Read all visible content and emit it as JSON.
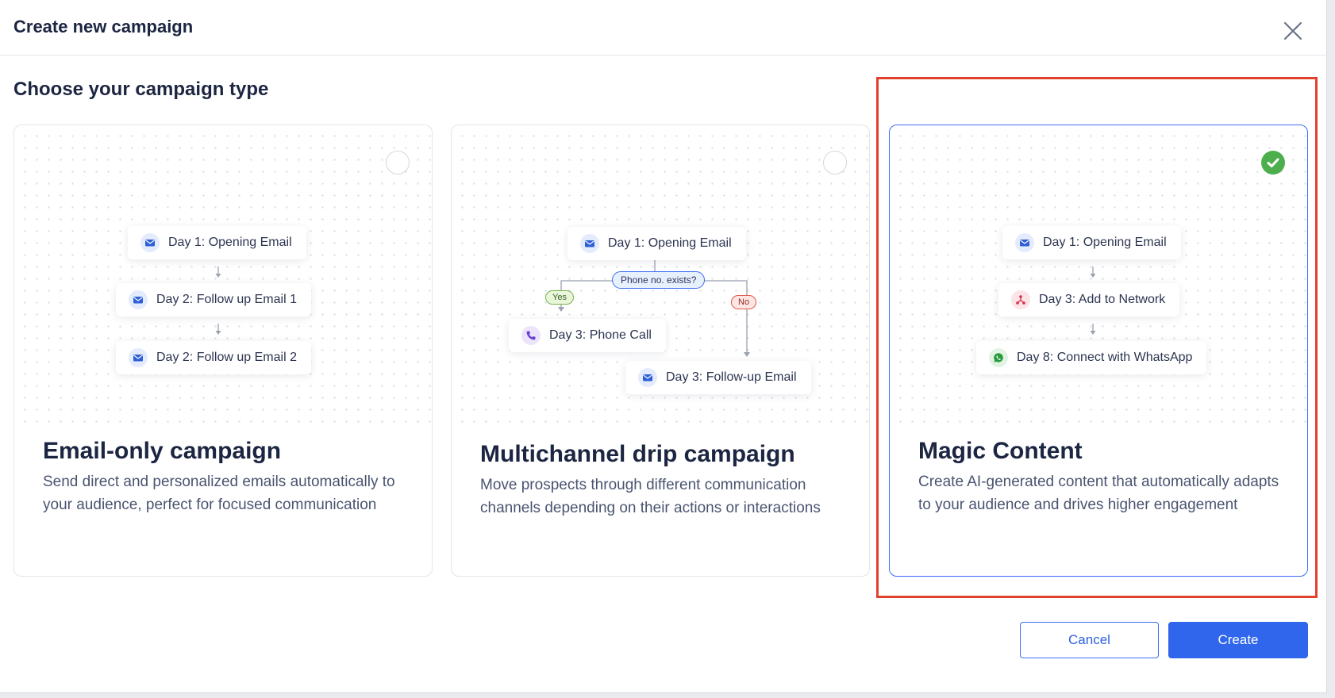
{
  "modal": {
    "title": "Create new campaign",
    "section_title": "Choose your campaign type"
  },
  "cards": [
    {
      "title": "Email-only campaign",
      "description": "Send direct and personalized emails automatically to your audience, perfect for focused communication",
      "selected": false,
      "steps": [
        {
          "label": "Day 1: Opening Email",
          "icon": "email-icon"
        },
        {
          "label": "Day 2: Follow up Email 1",
          "icon": "email-icon"
        },
        {
          "label": "Day 2: Follow up Email 2",
          "icon": "email-icon"
        }
      ]
    },
    {
      "title": "Multichannel drip campaign",
      "description": "Move prospects through different communication channels depending on their actions or interactions",
      "selected": false,
      "steps": [
        {
          "label": "Day 1: Opening Email",
          "icon": "email-icon"
        },
        {
          "label": "Day 3: Phone Call",
          "icon": "phone-icon"
        },
        {
          "label": "Day 3: Follow-up Email",
          "icon": "email-icon"
        }
      ],
      "condition": "Phone no. exists?",
      "yes_label": "Yes",
      "no_label": "No"
    },
    {
      "title": "Magic Content",
      "description": "Create AI-generated content that automatically adapts to your audience and drives higher engagement",
      "selected": true,
      "steps": [
        {
          "label": "Day 1: Opening Email",
          "icon": "email-icon"
        },
        {
          "label": "Day 3: Add to Network",
          "icon": "network-icon"
        },
        {
          "label": "Day 8: Connect with WhatsApp",
          "icon": "whatsapp-icon"
        }
      ]
    }
  ],
  "buttons": {
    "cancel": "Cancel",
    "create": "Create"
  },
  "colors": {
    "accent": "#2f66eb",
    "selected_check": "#4cae4c",
    "highlight": "#e2412e",
    "no_pill": "#e2574c",
    "yes_pill": "#79b34a"
  }
}
